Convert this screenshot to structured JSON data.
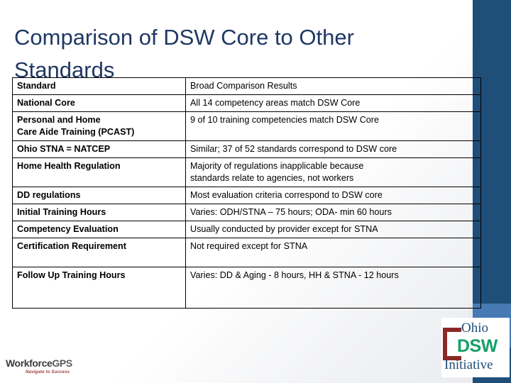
{
  "slide": {
    "title": "Comparison of DSW Core to Other Standards",
    "accent_navy": "#1f4e79",
    "accent_mid_blue": "#477ab5",
    "title_color": "#1f3864"
  },
  "table": {
    "headers": {
      "standard": "Standard",
      "results": "Broad Comparison Results"
    },
    "rows": [
      {
        "standard": "National Core",
        "standard_line2": "",
        "results": "All 14 competency areas match DSW Core",
        "results_line2": ""
      },
      {
        "standard": "Personal and Home",
        "standard_line2": "Care Aide Training (PCAST)",
        "results": "9 of 10 training competencies match DSW Core",
        "results_line2": ""
      },
      {
        "standard": "Ohio STNA = NATCEP",
        "standard_line2": "",
        "results": "Similar; 37 of 52 standards correspond to DSW core",
        "results_line2": ""
      },
      {
        "standard": "Home Health Regulation",
        "standard_line2": "",
        "results": "Majority of regulations inapplicable because",
        "results_line2": "standards relate to agencies, not workers"
      },
      {
        "standard": "DD regulations",
        "standard_line2": "",
        "results": "Most evaluation criteria correspond to DSW core",
        "results_line2": ""
      },
      {
        "standard": "Initial Training Hours",
        "standard_line2": "",
        "results": "Varies: ODH/STNA – 75 hours; ODA- min 60 hours",
        "results_line2": ""
      },
      {
        "standard": "Competency Evaluation",
        "standard_line2": "",
        "results": "Usually conducted by provider except for STNA",
        "results_line2": ""
      },
      {
        "standard": "Certification Requirement",
        "standard_line2": "",
        "results": "Not required except  for STNA",
        "results_line2": ""
      },
      {
        "standard": "Follow Up Training Hours",
        "standard_line2": "",
        "results": "Varies: DD & Aging - 8 hours, HH & STNA - 12 hours",
        "results_line2": ""
      }
    ]
  },
  "logos": {
    "workforce": {
      "name_main": "Workforce",
      "name_suffix": "GPS",
      "tagline": "Navigate to Success"
    },
    "dsw": {
      "line1": "Ohio",
      "line2": "DSW",
      "line3": "Initiative",
      "green": "#15a06a",
      "navy": "#1f4e79",
      "maroon": "#8b2828"
    }
  }
}
